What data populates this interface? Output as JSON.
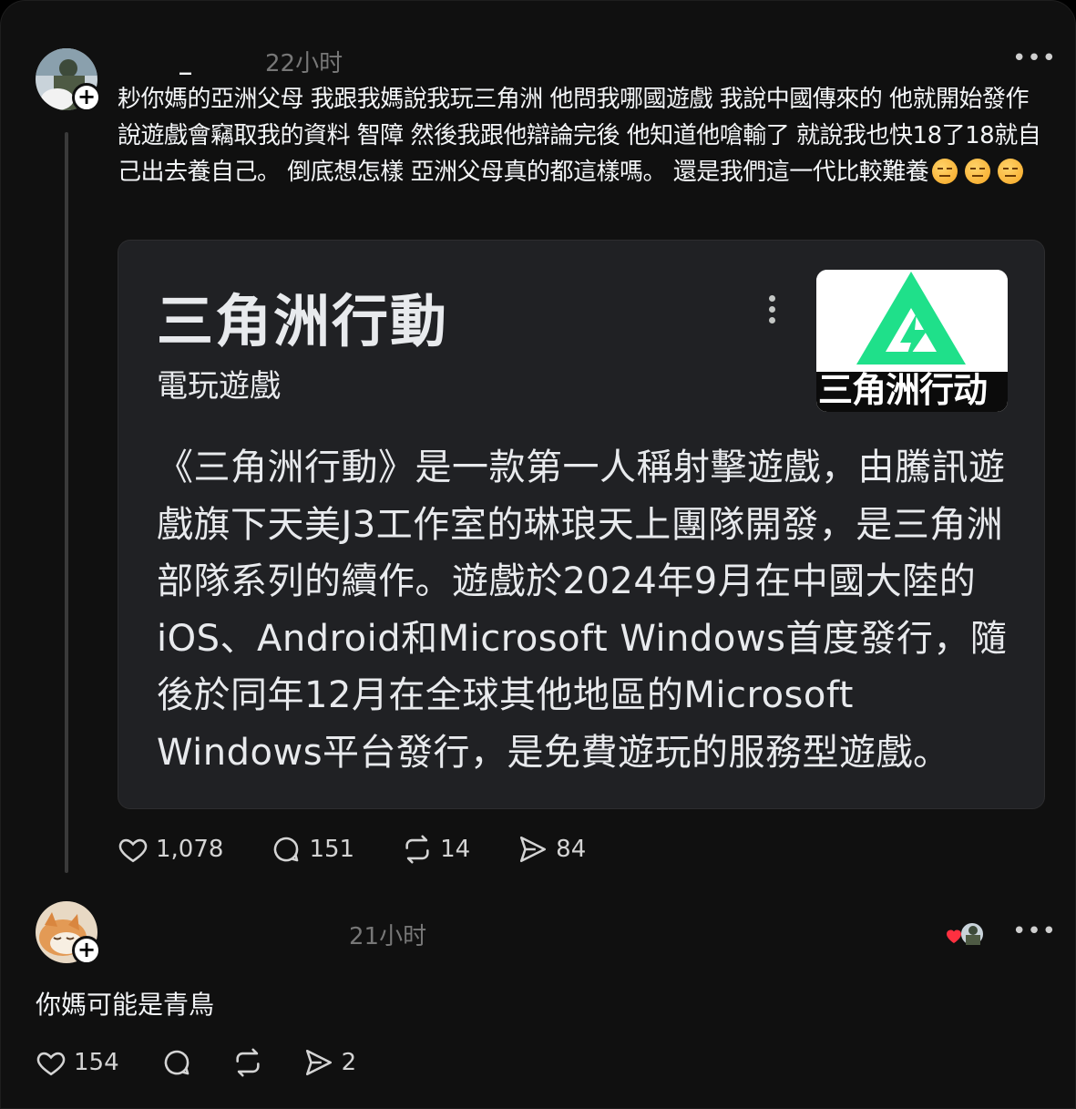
{
  "post": {
    "username": "_",
    "time": "22小时",
    "text": "耖你媽的亞洲父母 我跟我媽說我玩三角洲 他問我哪國遊戲 我說中國傳來的 他就開始發作 說遊戲會竊取我的資料 智障 然後我跟他辯論完後 他知道他嗆輸了 就說我也快18了18就自己出去養自己。 倒底想怎樣 亞洲父母真的都這樣嗎。 還是我們這一代比較難養",
    "emojis": [
      "expressionless-face",
      "expressionless-face",
      "expressionless-face"
    ],
    "card": {
      "title": "三角洲行動",
      "subtitle": "電玩遊戲",
      "logo_text": "三角洲行动",
      "description": "《三角洲行動》是一款第一人稱射擊遊戲，由騰訊遊戲旗下天美J3工作室的琳琅天上團隊開發，是三角洲部隊系列的續作。遊戲於2024年9月在中國大陸的iOS、Android和Microsoft Windows首度發行，隨後於同年12月在全球其他地區的Microsoft Windows平台發行，是免費遊玩的服務型遊戲。"
    },
    "actions": {
      "likes": "1,078",
      "comments": "151",
      "reposts": "14",
      "shares": "84"
    }
  },
  "reply": {
    "time": "21小时",
    "text": "你媽可能是青鳥",
    "actions": {
      "likes": "154",
      "shares": "2"
    }
  },
  "colors": {
    "background": "#101010",
    "card_bg": "#202124",
    "logo_green": "#1fe08a",
    "like_red": "#ff3040"
  },
  "icons": [
    "heart-icon",
    "comment-icon",
    "repost-icon",
    "share-icon",
    "more-icon",
    "follow-plus-icon"
  ]
}
